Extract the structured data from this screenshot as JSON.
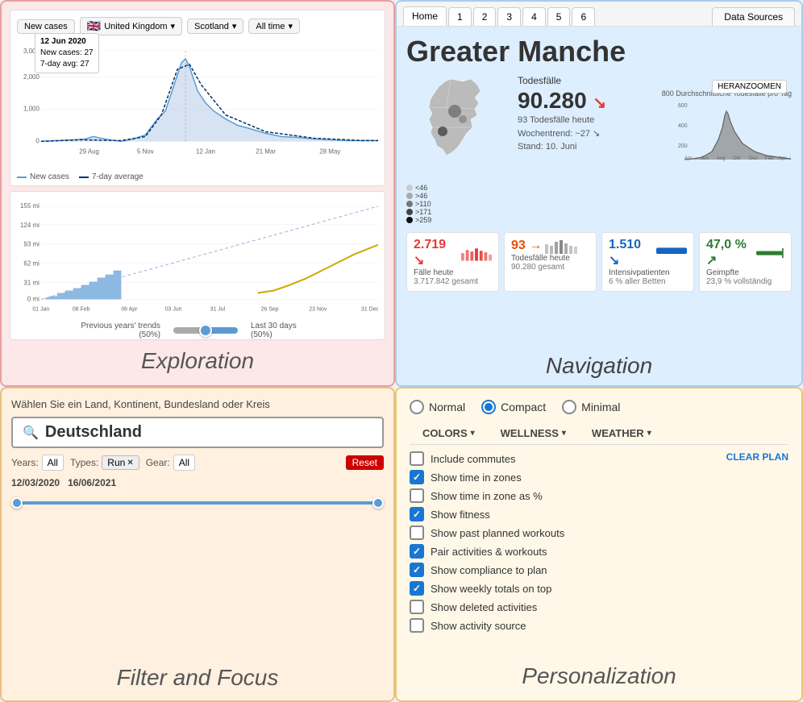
{
  "exploration": {
    "label": "Exploration",
    "toolbar": {
      "metric": "New cases",
      "country": "United Kingdom",
      "region": "Scotland",
      "time": "All time"
    },
    "tooltip": {
      "date": "12 Jun 2020",
      "new_cases": "New cases: 27",
      "avg": "7-day avg: 27"
    },
    "x_labels_top": [
      "29 Aug",
      "5 Nov",
      "12 Jan",
      "21 Mar",
      "28 May"
    ],
    "y_labels_top": [
      "3,000",
      "2,000",
      "1,000",
      "0"
    ],
    "legend_new": "New cases",
    "legend_avg": "7-day average",
    "x_labels_bottom": [
      "01 Jan",
      "08 Feb",
      "06 Apr",
      "03 Jun",
      "31 Jul",
      "26 Sep",
      "23 Nov",
      "31 Dec"
    ],
    "y_labels_bottom": [
      "155 mi",
      "124 mi",
      "93 mi",
      "62 mi",
      "31 mi",
      "0 mi"
    ],
    "slider_left": "Previous years' trends (50%)",
    "slider_right": "Last 30 days (50%)"
  },
  "navigation": {
    "label": "Navigation",
    "tabs": [
      "Home",
      "1",
      "2",
      "3",
      "4",
      "5",
      "6"
    ],
    "data_sources": "Data Sources",
    "title": "Greater Manche",
    "deaths_label": "Todesfälle",
    "deaths_value": "90.280",
    "deaths_today": "93 Todesfälle heute",
    "deaths_trend": "Wochentrend: ~27 ↘",
    "deaths_date": "Stand: 10. Juni",
    "trend_label": "800 Durchschnittliche Todesfälle pro Tag",
    "trend_x": [
      "Apr",
      "Jun",
      "Aug",
      "Okt",
      "Dez",
      "Feb",
      "Apr",
      "Ju"
    ],
    "trend_y": [
      "600",
      "400",
      "200"
    ],
    "zoom_btn": "HERANZOOMEN",
    "map_legend": [
      {
        "color": "#e0e0e0",
        "label": "<46"
      },
      {
        "color": "#aaaaaa",
        "label": ">46"
      },
      {
        "color": "#777777",
        "label": ">110"
      },
      {
        "color": "#444444",
        "label": ">171"
      },
      {
        "color": "#111111",
        "label": ">259"
      }
    ],
    "cards": [
      {
        "value": "2.719",
        "arrow": "↘",
        "color": "red",
        "mini": "mini-bar-red",
        "label": "Fälle heute",
        "sub": "3.717.842 gesamt"
      },
      {
        "value": "93",
        "arrow": "→",
        "color": "orange",
        "mini": "mini-bar-orange",
        "label": "Todesfälle heute",
        "sub": "90.280 gesamt"
      },
      {
        "value": "1.510",
        "arrow": "↘",
        "color": "blue",
        "mini": "mini-bar-blue",
        "label": "Intensivpatienten",
        "sub": "6 % aller Betten"
      },
      {
        "value": "47,0 %",
        "arrow": "↗",
        "color": "green",
        "mini": "mini-bar-green",
        "label": "Geimpfte",
        "sub": "23,9 % vollständig"
      }
    ]
  },
  "filter": {
    "label": "Filter and Focus",
    "location_prompt": "Wählen Sie ein Land, Kontinent, Bundesland oder Kreis",
    "search_icon": "🔍",
    "search_value": "Deutschland",
    "years_label": "Years:",
    "years_value": "All",
    "types_label": "Types:",
    "types_value": "Run",
    "gear_label": "Gear:",
    "gear_value": "All",
    "reset_label": "Reset",
    "date_from": "12/03/2020",
    "date_to": "16/06/2021"
  },
  "personalization": {
    "label": "Personalization",
    "view_options": [
      "Normal",
      "Compact",
      "Minimal"
    ],
    "selected_view": "Compact",
    "menus": [
      "COLORS",
      "WELLNESS",
      "WEATHER"
    ],
    "clear_plan": "CLEAR PLAN",
    "checkboxes": [
      {
        "label": "Include commutes",
        "checked": false
      },
      {
        "label": "Show time in zones",
        "checked": true
      },
      {
        "label": "Show time in zone as %",
        "checked": false
      },
      {
        "label": "Show fitness",
        "checked": true
      },
      {
        "label": "Show past planned workouts",
        "checked": false
      },
      {
        "label": "Pair activities & workouts",
        "checked": true
      },
      {
        "label": "Show compliance to plan",
        "checked": true
      },
      {
        "label": "Show weekly totals on top",
        "checked": true
      },
      {
        "label": "Show deleted activities",
        "checked": false
      },
      {
        "label": "Show activity source",
        "checked": false
      }
    ]
  }
}
